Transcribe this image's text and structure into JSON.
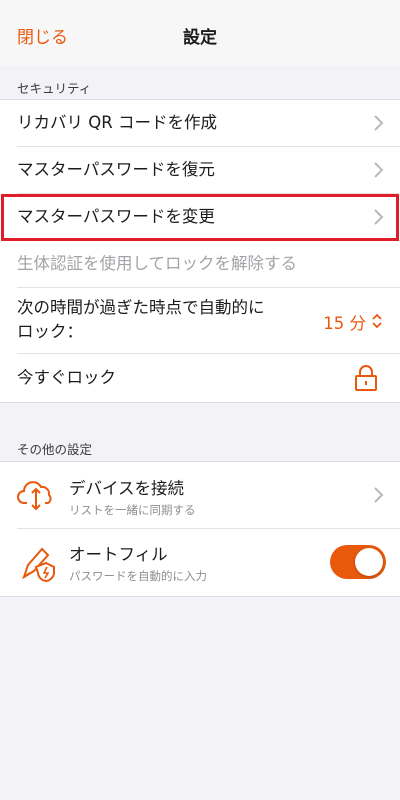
{
  "nav": {
    "close_label": "閉じる",
    "title": "設定"
  },
  "security": {
    "header": "セキュリティ",
    "items": [
      {
        "label": "リカバリ QR コードを作成"
      },
      {
        "label": "マスターパスワードを復元"
      },
      {
        "label": "マスターパスワードを変更",
        "highlighted": true
      },
      {
        "label": "生体認証を使用してロックを解除する",
        "disabled": true
      }
    ],
    "autolock": {
      "label_line1": "次の時間が過ぎた時点で自動的に",
      "label_line2": "ロック：",
      "value": "15 分"
    },
    "lock_now": {
      "label": "今すぐロック",
      "icon": "lock-icon"
    }
  },
  "other": {
    "header": "その他の設定",
    "connect": {
      "title": "デバイスを接続",
      "description": "リストを一緒に同期する",
      "icon": "cloud-sync-icon"
    },
    "autofill": {
      "title": "オートフィル",
      "description": "パスワードを自動的に入力",
      "icon": "pen-shield-icon",
      "enabled": true
    }
  },
  "colors": {
    "accent": "#e8590c",
    "highlight_border": "#e01e2b",
    "background": "#f2f2f7"
  }
}
